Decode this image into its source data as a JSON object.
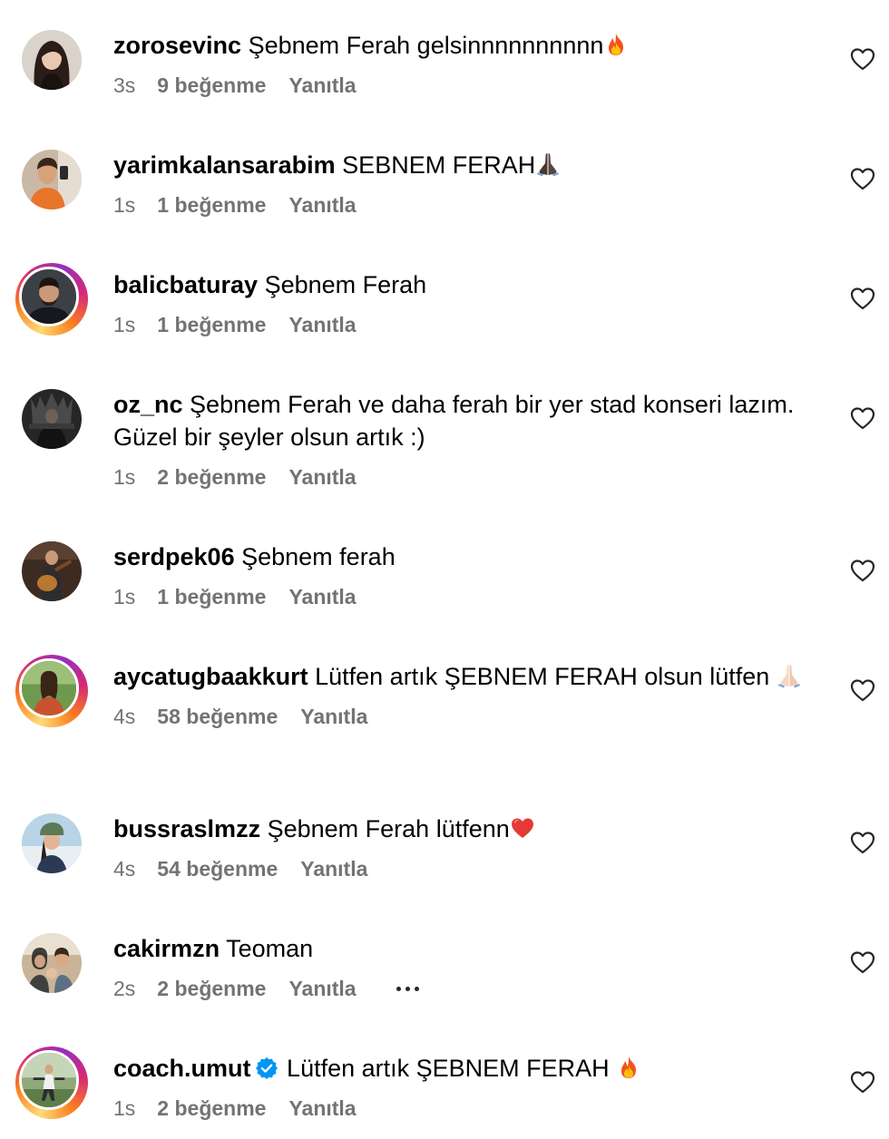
{
  "comments": [
    {
      "username": "zorosevinc",
      "text": "Şebnem Ferah gelsinnnnnnnnnn",
      "emoji": "fire",
      "time": "3s",
      "likes": "9 beğenme",
      "reply": "Yanıtla",
      "story_ring": false,
      "verified": false,
      "more": false,
      "avatar_icon": "avatar-woman-long-hair"
    },
    {
      "username": "yarimkalansarabim",
      "text": "SEBNEM FERAH",
      "emoji": "pray-dark",
      "time": "1s",
      "likes": "1 beğenme",
      "reply": "Yanıtla",
      "story_ring": false,
      "verified": false,
      "more": false,
      "avatar_icon": "avatar-mirror-selfie"
    },
    {
      "username": "balicbaturay",
      "text": "Şebnem Ferah",
      "emoji": "",
      "time": "1s",
      "likes": "1 beğenme",
      "reply": "Yanıtla",
      "story_ring": true,
      "verified": false,
      "more": false,
      "avatar_icon": "avatar-man-beard"
    },
    {
      "username": "oz_nc",
      "text": "Şebnem Ferah ve daha ferah bir yer stad konseri lazım. Güzel bir şeyler olsun artık :)",
      "emoji": "",
      "time": "1s",
      "likes": "2 beğenme",
      "reply": "Yanıtla",
      "story_ring": false,
      "verified": false,
      "more": false,
      "avatar_icon": "avatar-dark-throne"
    },
    {
      "username": "serdpek06",
      "text": "Şebnem ferah",
      "emoji": "",
      "time": "1s",
      "likes": "1 beğenme",
      "reply": "Yanıtla",
      "story_ring": false,
      "verified": false,
      "more": false,
      "avatar_icon": "avatar-guitarist"
    },
    {
      "username": "aycatugbaakkurt",
      "text": "Lütfen artık ŞEBNEM FERAH olsun lütfen",
      "emoji": "pray-light",
      "time": "4s",
      "likes": "58 beğenme",
      "reply": "Yanıtla",
      "story_ring": true,
      "verified": false,
      "more": false,
      "avatar_icon": "avatar-woman-park"
    },
    {
      "username": "bussraslmzz",
      "text": "Şebnem Ferah lütfenn",
      "emoji": "red-heart",
      "time": "4s",
      "likes": "54 beğenme",
      "reply": "Yanıtla",
      "story_ring": false,
      "verified": false,
      "more": false,
      "avatar_icon": "avatar-woman-hat"
    },
    {
      "username": "cakirmzn",
      "text": "Teoman",
      "emoji": "",
      "time": "2s",
      "likes": "2 beğenme",
      "reply": "Yanıtla",
      "story_ring": false,
      "verified": false,
      "more": true,
      "avatar_icon": "avatar-family"
    },
    {
      "username": "coach.umut",
      "text": "Lütfen artık ŞEBNEM FERAH",
      "emoji": "fire",
      "time": "1s",
      "likes": "2 beğenme",
      "reply": "Yanıtla",
      "story_ring": true,
      "verified": true,
      "more": false,
      "avatar_icon": "avatar-outdoor-fitness"
    }
  ],
  "colors": {
    "meta_gray": "#737373",
    "verified_blue": "#0095f6",
    "text": "#000000"
  }
}
